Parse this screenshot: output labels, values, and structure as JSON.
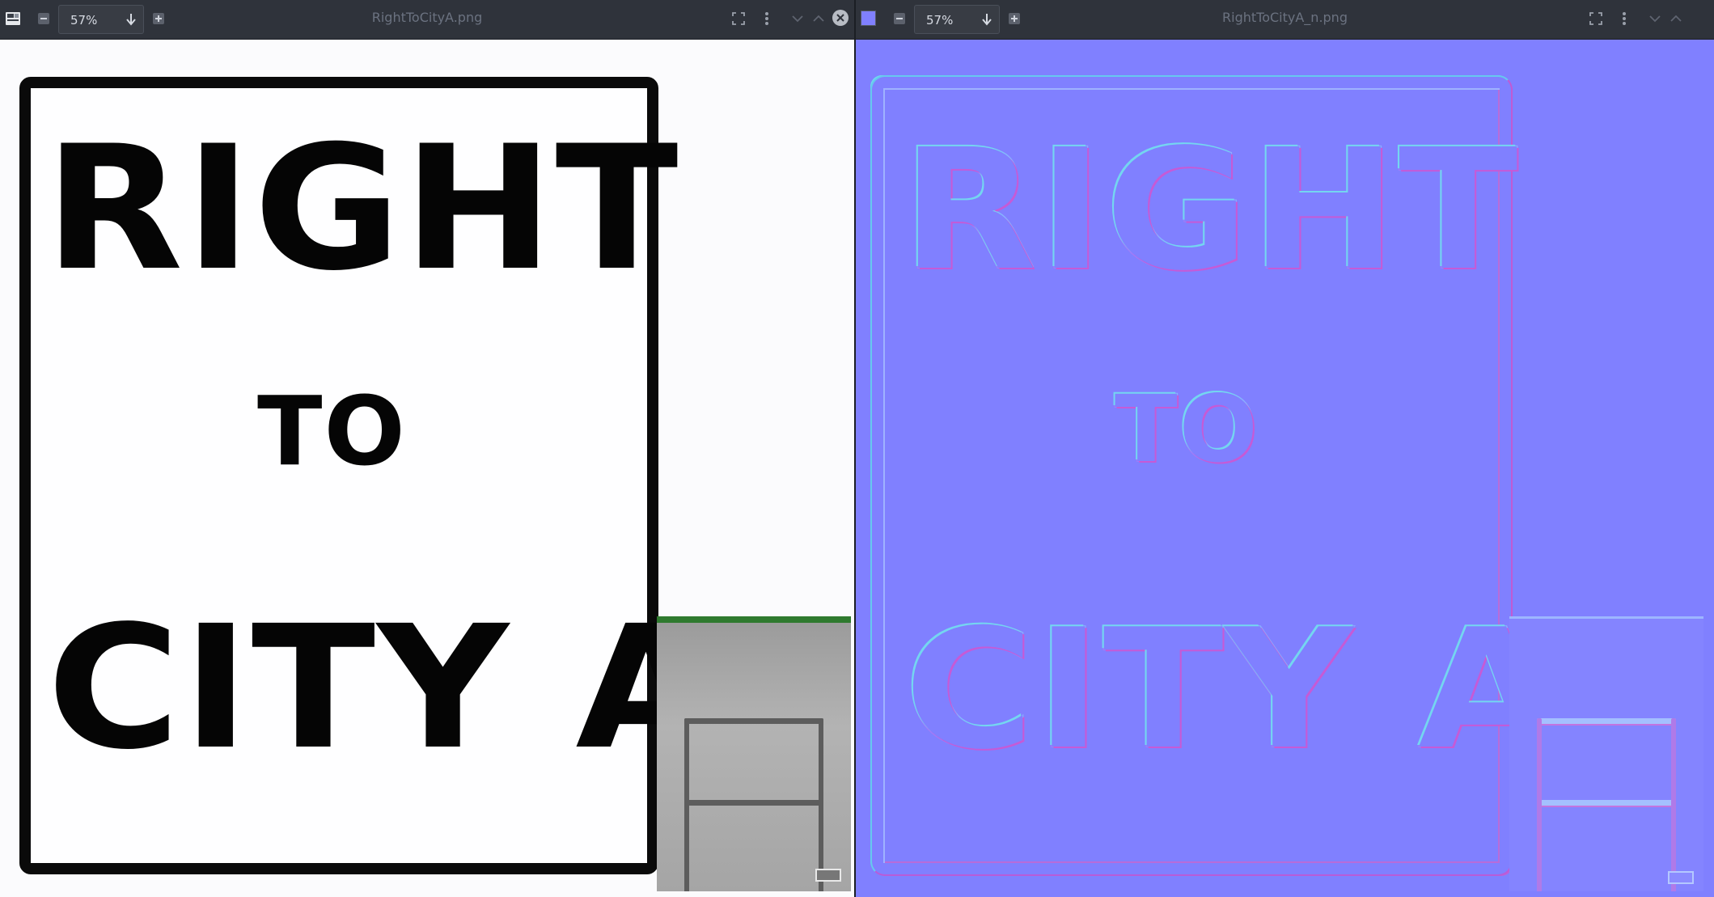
{
  "left_pane": {
    "zoom": "57%",
    "filename": "RightToCityA.png",
    "sign": {
      "line1": "RIGHT",
      "line2": "TO",
      "line3": "CITY A"
    }
  },
  "right_pane": {
    "zoom": "57%",
    "filename": "RightToCityA_n.png",
    "color_swatch": "#8080ff",
    "sign": {
      "line1": "RIGHT",
      "line2": "TO",
      "line3": "CITY A"
    }
  },
  "colors": {
    "toolbar_bg": "#2f333b",
    "normal_map_base": "#8080ff",
    "left_canvas_bg": "#fbfbfd"
  },
  "icons": {
    "app": "viewer-app-icon",
    "zoom_out": "zoom-out-icon",
    "zoom_in": "zoom-in-icon",
    "zoom_dropdown": "arrow-down-icon",
    "fullscreen": "fullscreen-icon",
    "menu": "more-vertical-icon",
    "prev": "chevron-down-icon",
    "next": "chevron-up-icon",
    "close": "close-icon"
  }
}
